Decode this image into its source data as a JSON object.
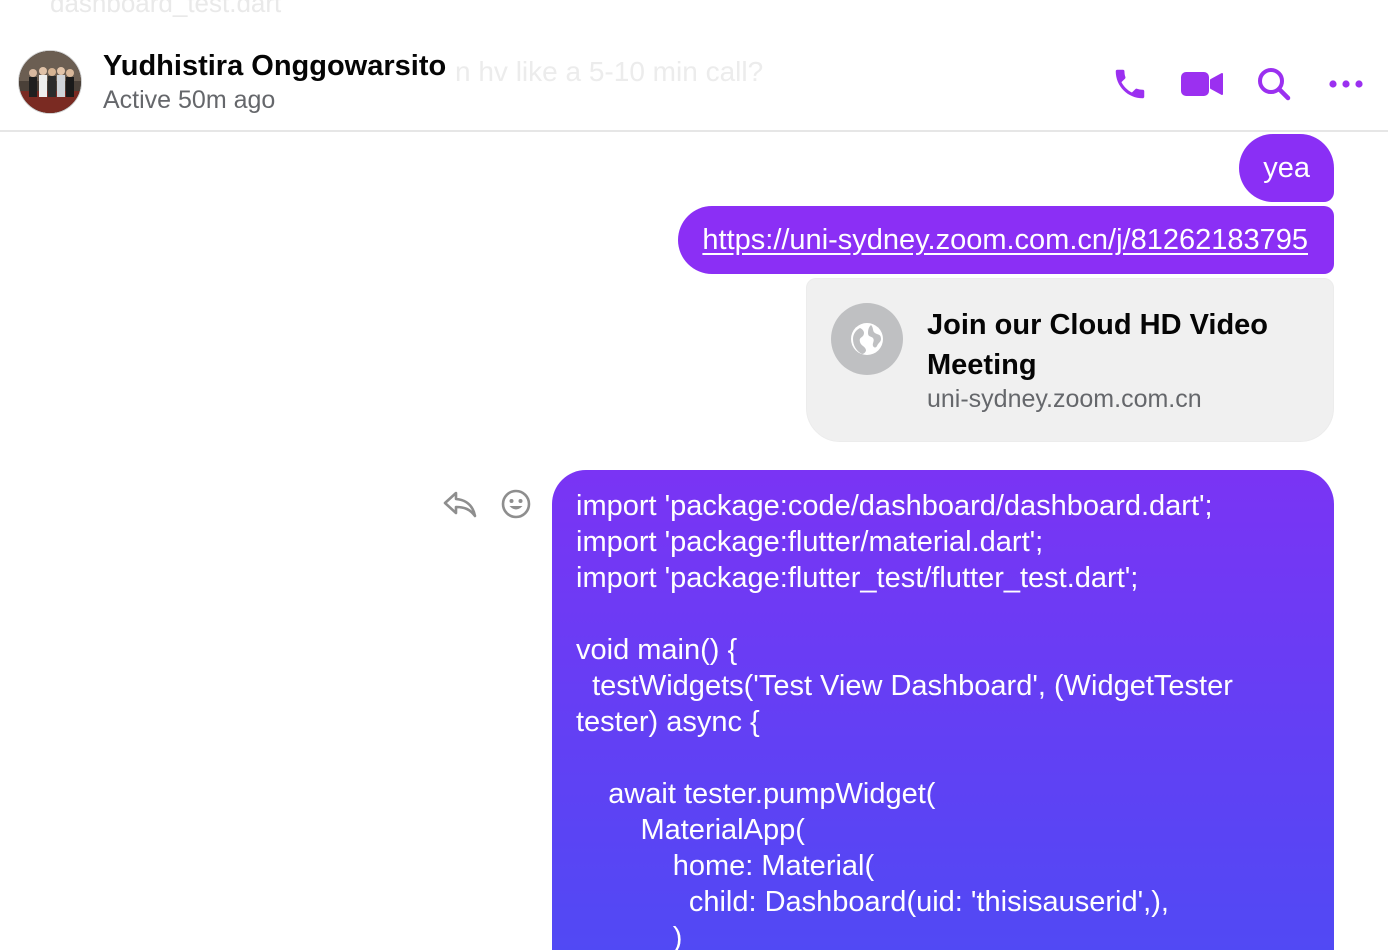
{
  "background": {
    "ghost_top_text": "dashboard_test.dart",
    "ghost_mid_text": "n hv like a 5-10 min call?"
  },
  "header": {
    "contact_name": "Yudhistira Onggowarsito",
    "status": "Active 50m ago",
    "actions": [
      {
        "name": "audio-call",
        "icon": "phone-icon"
      },
      {
        "name": "video-call",
        "icon": "video-camera-icon"
      },
      {
        "name": "search-in-conversation",
        "icon": "search-icon"
      },
      {
        "name": "more-options",
        "icon": "more-horizontal-icon"
      }
    ]
  },
  "messages": {
    "msg1_text": "yea",
    "msg2_link": "https://uni-sydney.zoom.com.cn/j/81262183795",
    "link_preview": {
      "title": "Join our Cloud HD Video Meeting",
      "domain": "uni-sydney.zoom.com.cn",
      "icon": "globe-icon"
    },
    "code_message": "import 'package:code/dashboard/dashboard.dart';\nimport 'package:flutter/material.dart';\nimport 'package:flutter_test/flutter_test.dart';\n\nvoid main() {\n  testWidgets('Test View Dashboard', (WidgetTester tester) async {\n\n    await tester.pumpWidget(\n        MaterialApp(\n            home: Material(\n              child: Dashboard(uid: 'thisisauserid',),\n            )",
    "hover_actions": [
      {
        "name": "reply",
        "icon": "reply-icon"
      },
      {
        "name": "react",
        "icon": "smiley-icon"
      }
    ]
  },
  "colors": {
    "accent": "#8a2ff5",
    "bubble_gradient_top": "#7a34f4",
    "bubble_gradient_bottom": "#4e4bf4",
    "secondary_text": "#65676b"
  }
}
